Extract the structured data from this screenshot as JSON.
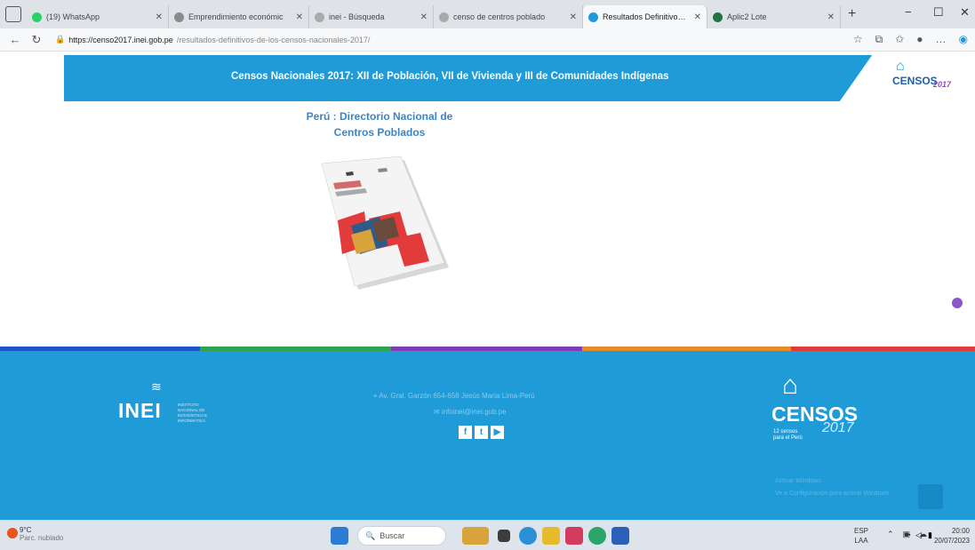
{
  "browser": {
    "tabs": [
      {
        "label": "(19) WhatsApp",
        "color": "#25d366"
      },
      {
        "label": "Emprendimiento económic",
        "color": "#8a8a8a"
      },
      {
        "label": "inei - Búsqueda",
        "color": "#aaaaaa"
      },
      {
        "label": "censo de centros poblado",
        "color": "#aaaaaa"
      },
      {
        "label": "Resultados Definitivos de l",
        "color": "#1f9cd8",
        "active": true
      },
      {
        "label": "Aplic2 Lote",
        "color": "#217346"
      }
    ],
    "new_tab": "+",
    "minimize": "−",
    "maximize": "☐",
    "close": "✕",
    "url_host": "https://censo2017.inei.gob.pe",
    "url_path": "/resultados-definitivos-de-los-censos-nacionales-2017/"
  },
  "banner": {
    "title": "Censos Nacionales 2017: XII de Población, VII de Vivienda y III de Comunidades Indígenas",
    "logo_text": "CENSOS",
    "logo_year": "2017"
  },
  "content": {
    "book_title_line1": "Perú : Directorio Nacional de",
    "book_title_line2": "Centros Poblados"
  },
  "footer": {
    "inei_logo": "INEI",
    "inei_sub": "INSTITUTO NACIONAL DE ESTADÍSTICA E INFORMÁTICA",
    "address": "Av. Gral. Garzón 654-658 Jesús María Lima-Perú",
    "email": "infoinei@inei.gob.pe",
    "social": [
      "f",
      "t",
      "▶"
    ],
    "censos_logo": "CENSOS",
    "censos_sub_line1": "12 censos",
    "censos_sub_line2": "para el Perú",
    "censos_year": "2017",
    "activate_line1": "Activar Windows",
    "activate_line2": "Ve a Configuración para activar Windows."
  },
  "stripes": [
    "#1a56c8",
    "#2ea44f",
    "#7b3fb3",
    "#e58c2a",
    "#e23b3b"
  ],
  "taskbar": {
    "weather_temp": "9°C",
    "weather_desc": "Parc. nublado",
    "search_placeholder": "Buscar",
    "lang1": "ESP",
    "lang2": "LAA",
    "time": "20:00",
    "date": "20/07/2023"
  }
}
